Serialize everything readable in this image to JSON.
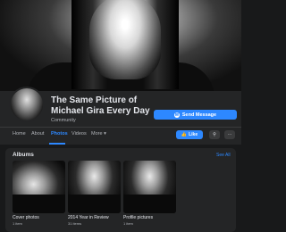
{
  "page": {
    "title": "The Same Picture of Michael Gira Every Day",
    "category": "Community",
    "send_message": "Send Message"
  },
  "nav": {
    "tabs": [
      {
        "label": "Home"
      },
      {
        "label": "About"
      },
      {
        "label": "Photos",
        "active": true
      },
      {
        "label": "Videos"
      },
      {
        "label": "More",
        "icon": "caret-down-icon"
      }
    ],
    "like": "Like",
    "search_icon": "search-icon",
    "more_icon": "ellipsis-icon"
  },
  "albums": {
    "title": "Albums",
    "see_all": "See All",
    "items": [
      {
        "name": "Cover photos",
        "count": "1 item"
      },
      {
        "name": "2014 Year in Review",
        "count": "31 items"
      },
      {
        "name": "Profile pictures",
        "count": "1 item"
      }
    ]
  },
  "colors": {
    "accent": "#2d88ff",
    "background": "#18191a",
    "surface": "#242526"
  }
}
